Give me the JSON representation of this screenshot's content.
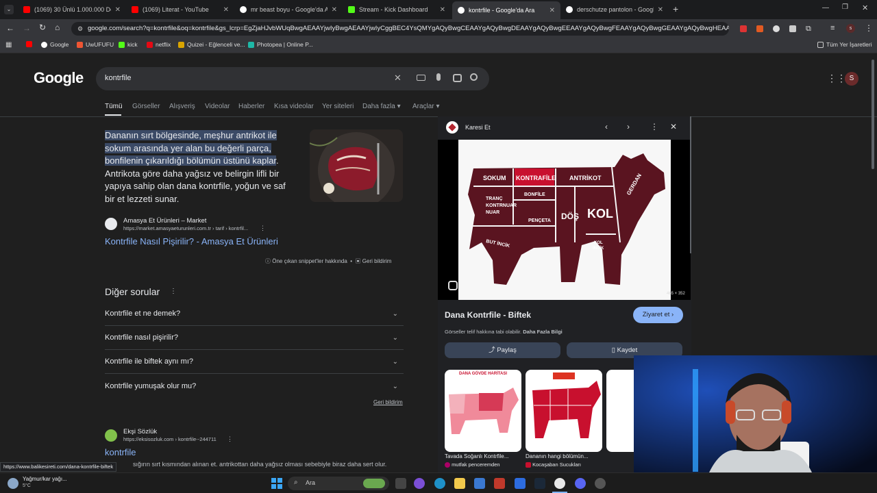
{
  "tabs": [
    {
      "label": "(1069) 30 Ünlü 1.000.000 Dolar",
      "color": "#ff0000"
    },
    {
      "label": "(1069) Literat - YouTube",
      "color": "#ff0000"
    },
    {
      "label": "mr beast boyu - Google'da Ara",
      "color": "#ffffff"
    },
    {
      "label": "Stream - Kick Dashboard",
      "color": "#53fc18"
    },
    {
      "label": "kontrfile - Google'da Ara",
      "color": "#ffffff"
    },
    {
      "label": "derschutze pantolon - Google'",
      "color": "#ffffff"
    }
  ],
  "address": "google.com/search?q=kontrfile&oq=kontrfile&gs_lcrp=EgZjaHJvbWUqBwgAEAAYjwIyBwgAEAAYjwIyCggBEC4YsQMYgAQyBwgCEAAYgAQyBwgDEAAYgAQyBwgEEAAYgAQyBwgFEAAYgAQyBwgGEAAYgAQyBwgHEAAYgAQ...",
  "bookmarks": [
    "Google",
    "UwUFUFU",
    "kick",
    "netflix",
    "Quizei - Eğlenceli ve...",
    "Photopea | Online P..."
  ],
  "bookmarks_all": "Tüm Yer İşaretleri",
  "google_logo": "Google",
  "search_query": "kontrfile",
  "avatar_letter": "S",
  "nav_tabs": [
    "Tümü",
    "Görseller",
    "Alışveriş",
    "Videolar",
    "Haberler",
    "Kısa videolar",
    "Yer siteleri",
    "Daha fazla",
    "Araçlar"
  ],
  "snippet": {
    "highlight": "Dananın sırt bölgesinde, meşhur antrikot ile sokum arasında yer alan bu değerli parça, bonfilenin çıkarıldığı bölümün üstünü kaplar",
    "rest": ". Antrikota göre daha yağsız ve belirgin lifli bir yapıya sahip olan dana kontrfile, yoğun ve saf bir et lezzeti sunar.",
    "source_name": "Amasya Et Ürünleri – Market",
    "source_url": "https://market.amasyaeturunleri.com.tr › tarif › kontrfil...",
    "link": "Kontrfile Nasıl Pişirilir? - Amasya Et Ürünleri",
    "about": "Öne çıkan snippet'ler hakkında",
    "feedback": "Geri bildirim"
  },
  "other_questions_title": "Diğer sorular",
  "questions": [
    "Kontrfile et ne demek?",
    "Kontrfile nasıl pişirilir?",
    "Kontrfile ile biftek aynı mı?",
    "Kontrfile yumuşak olur mu?"
  ],
  "questions_feedback": "Geri bildirim",
  "result2": {
    "site": "Ekşi Sözlük",
    "url": "https://eksisozluk.com › kontrfile--244711",
    "title": "kontrfile",
    "text": "sığırın sırt kısmından alınan et. antrikottan daha yağsız olması sebebiyle biraz daha sert olur."
  },
  "status_url": "https://www.balikesireti.com/dana-kontrfile-biftek",
  "panel": {
    "source": "Karesi Et",
    "size": "465 × 352",
    "title": "Dana Kontrfile - Biftek",
    "visit": "Ziyaret et",
    "copyright": "Görseller telif hakkına tabi olabilir.",
    "more_info": "Daha Fazla Bilgi",
    "share": "Paylaş",
    "save": "Kaydet",
    "cow_labels": [
      "SOKUM",
      "KONTRAFİLE",
      "ANTRİKOT",
      "GERDAN",
      "TRANÇ KONTRNUAR NUAR",
      "BONFİLE",
      "PENÇETA",
      "DÖŞ",
      "KOL",
      "BUT İNCİK",
      "KOL İNCİK"
    ],
    "related": [
      {
        "title": "Tavada Soğanlı Kontrfile...",
        "source": "mutfak penceremden",
        "header": "DANA GÖVDE HARİTASI"
      },
      {
        "title": "Dananın hangi bölümün...",
        "source": "Kocaşaban Sucukları",
        "header": ""
      }
    ]
  },
  "weather": {
    "line1": "Yağmur/kar yağı...",
    "line2": "5°C"
  },
  "taskbar_search": "Ara"
}
